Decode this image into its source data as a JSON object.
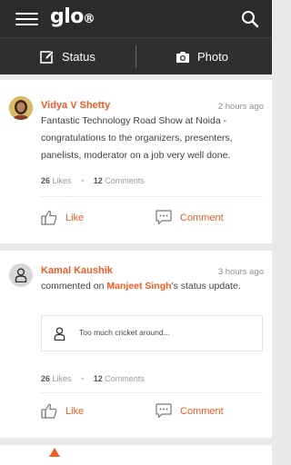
{
  "header": {
    "logo_text": "glo",
    "logo_mark": "R",
    "menu_icon": "hamburger-icon",
    "search_icon": "search-icon"
  },
  "actions": {
    "status_label": "Status",
    "photo_label": "Photo"
  },
  "posts": [
    {
      "author": "Vidya V Shetty",
      "time": "2 hours ago",
      "text": "Fantastic Technology Road Show at Noida - congratulations to the organizers, presenters, panelists, moderator on a job very well done.",
      "likes_count": "26",
      "likes_label": "Likes",
      "comments_count": "12",
      "comments_label": "Comments",
      "like_label": "Like",
      "comment_label": "Comment"
    },
    {
      "author": "Kamal Kaushik",
      "time": "3 hours ago",
      "text_prefix": "commented on ",
      "mention": "Manjeet Singh",
      "text_suffix": "'s status update.",
      "quote_text": "Too much cricket around...",
      "likes_count": "26",
      "likes_label": "Likes",
      "comments_count": "12",
      "comments_label": "Comments",
      "like_label": "Like",
      "comment_label": "Comment"
    }
  ],
  "colors": {
    "accent": "#ef5b25",
    "topbar": "#2b2b2b",
    "feed_bg": "#e9e9e9"
  }
}
